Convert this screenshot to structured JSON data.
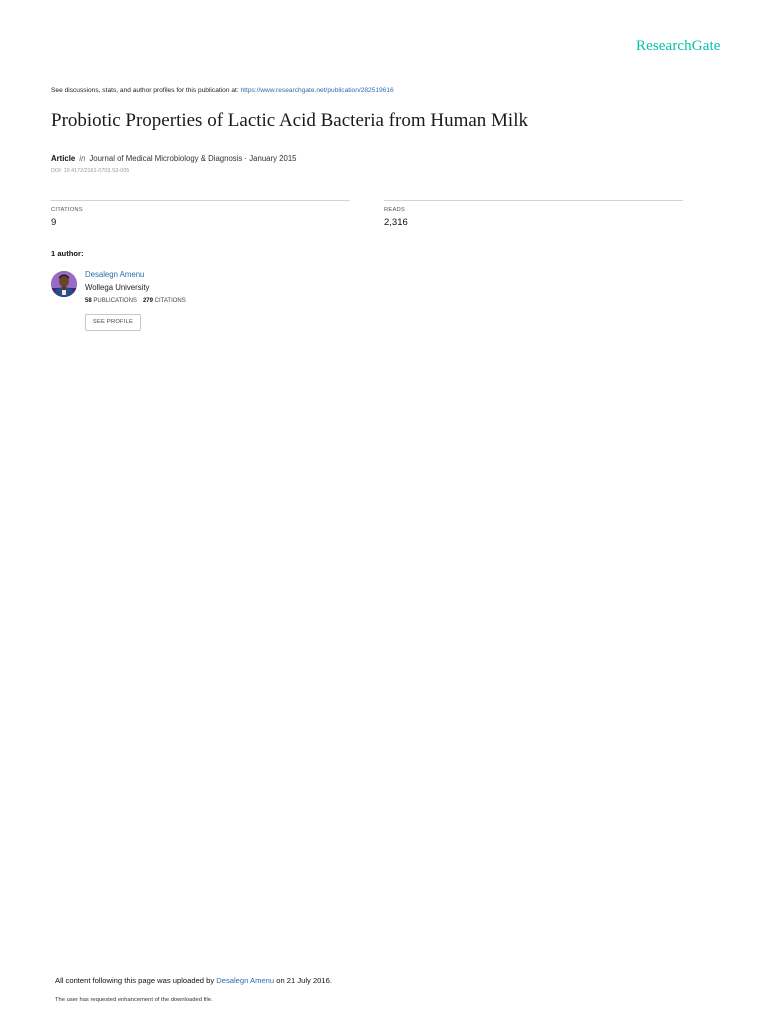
{
  "brand": {
    "logo_text": "ResearchGate",
    "color": "#00c3a8"
  },
  "intro": {
    "text": "See discussions, stats, and author profiles for this publication at: ",
    "link": "https://www.researchgate.net/publication/282519616"
  },
  "publication": {
    "title": "Probiotic Properties of Lactic Acid Bacteria from Human Milk",
    "type": "Article",
    "in_label": "in",
    "venue": "Journal of Medical Microbiology & Diagnosis · January 2015",
    "doi": "DOI: 10.4172/2161-0703.S3-005"
  },
  "stats": {
    "citations_label": "CITATIONS",
    "citations_value": "9",
    "reads_label": "READS",
    "reads_value": "2,316"
  },
  "authors": {
    "heading": "1 author:",
    "list": [
      {
        "name": "Desalegn Amenu",
        "institution": "Wollega University",
        "publications_count": "58",
        "publications_label": "PUBLICATIONS",
        "citations_count": "279",
        "citations_label": "CITATIONS",
        "see_profile_label": "SEE PROFILE"
      }
    ]
  },
  "footer": {
    "upload_prefix": "All content following this page was uploaded by ",
    "uploader": "Desalegn Amenu",
    "upload_suffix": " on 21 July 2016.",
    "note": "The user has requested enhancement of the downloaded file."
  },
  "colors": {
    "link": "#2a6cb0",
    "accent": "#00c3a8"
  }
}
